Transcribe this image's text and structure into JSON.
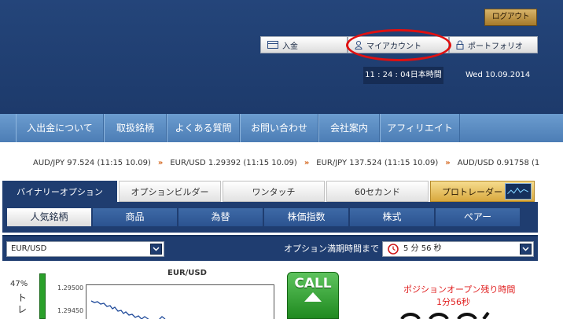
{
  "header": {
    "logout_label": "ログアウト",
    "links": [
      {
        "label": "入金",
        "icon": "card-icon"
      },
      {
        "label": "マイアカウント",
        "icon": "user-icon"
      },
      {
        "label": "ポートフォリオ",
        "icon": "lock-icon"
      }
    ],
    "clock": "11 : 24 : 04日本時間",
    "date": "Wed 10.09.2014"
  },
  "nav": {
    "items": [
      "入出金について",
      "取扱銘柄",
      "よくある質問",
      "お問い合わせ",
      "会社案内",
      "アフィリエイト"
    ]
  },
  "ticker": {
    "items": [
      "AUD/JPY 97.524 (11:15 10.09)",
      "EUR/USD 1.29392 (11:15 10.09)",
      "EUR/JPY 137.524 (11:15 10.09)",
      "AUD/USD 0.91758 (1"
    ],
    "separator": "»"
  },
  "main_tabs": [
    {
      "label": "バイナリーオプション",
      "active": true
    },
    {
      "label": "オプションビルダー",
      "active": false
    },
    {
      "label": "ワンタッチ",
      "active": false
    },
    {
      "label": "60セカンド",
      "active": false
    },
    {
      "label": "プロトレーダー",
      "active": false
    }
  ],
  "categories": [
    {
      "label": "人気銘柄",
      "active": true
    },
    {
      "label": "商品",
      "active": false
    },
    {
      "label": "為替",
      "active": false
    },
    {
      "label": "株価指数",
      "active": false
    },
    {
      "label": "株式",
      "active": false
    },
    {
      "label": "ペアー",
      "active": false
    }
  ],
  "selector": {
    "pair_value": "EUR/USD",
    "expiry_label": "オプション満期時間まで",
    "expiry_value": "5 分 56 秒"
  },
  "panel": {
    "percent": "47%",
    "trade_label": "トレー",
    "chart_title": "EUR/USD",
    "y_ticks": [
      "1.29500",
      "1.29450"
    ],
    "call_label": "CALL",
    "remaining_label": "ポジションオープン残り時間",
    "remaining_time": "1分56秒"
  },
  "colors": {
    "header_bg": "#1f3d70",
    "nav_bg": "#5b8ac0",
    "accent_gold": "#d9a93e",
    "call_green": "#2aa02a",
    "alert_red": "#e02020"
  }
}
